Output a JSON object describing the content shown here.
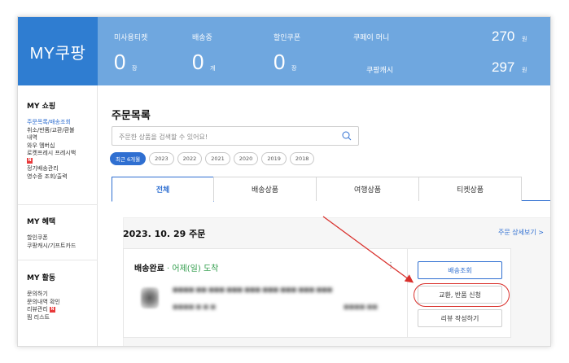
{
  "brand": {
    "title": "MY쿠팡"
  },
  "stats": {
    "items": [
      {
        "label": "미사용티켓",
        "value": "0",
        "unit": "장"
      },
      {
        "label": "배송중",
        "value": "0",
        "unit": "개"
      },
      {
        "label": "할인쿠폰",
        "value": "0",
        "unit": "장"
      }
    ],
    "right": [
      {
        "label": "쿠페이 머니",
        "value": "270",
        "unit": "원"
      },
      {
        "label": "쿠팡캐시",
        "value": "297",
        "unit": "원"
      }
    ]
  },
  "sidebar": {
    "sections": [
      {
        "title": "MY 쇼핑",
        "items": [
          {
            "label": "주문목록/배송조회",
            "active": true
          },
          {
            "label": "취소/반품/교환/환불"
          },
          {
            "label": "내역"
          },
          {
            "label": "와우 멤버십"
          },
          {
            "label": "로켓프레시 프레시백"
          },
          {
            "label": "",
            "badge": "N"
          },
          {
            "label": "정기배송관리"
          },
          {
            "label": "영수증 조회/출력"
          }
        ]
      },
      {
        "title": "MY 혜택",
        "items": [
          {
            "label": "할인쿠폰"
          },
          {
            "label": "쿠팡캐시/기프트카드"
          }
        ]
      },
      {
        "title": "MY 활동",
        "items": [
          {
            "label": "문의하기"
          },
          {
            "label": "문의내역 확인"
          },
          {
            "label": "리뷰관리",
            "badge": "N"
          },
          {
            "label": "찜 리스트"
          }
        ]
      }
    ]
  },
  "main": {
    "title": "주문목록",
    "search_placeholder": "주문한 상품을 검색할 수 있어요!",
    "year_chips": [
      "최근 6개월",
      "2023",
      "2022",
      "2021",
      "2020",
      "2019",
      "2018"
    ],
    "tabs": [
      "전체",
      "배송상품",
      "여행상품",
      "티켓상품"
    ],
    "order": {
      "date": "2023. 10. 29 주문",
      "detail_link": "주문 상세보기 >",
      "status": "배송완료",
      "separator": "·",
      "eta": "어제(일) 도착",
      "product_name": "■■■■ ■■ ■■■ ■■■ ■■■ ■■■ ■■■ ■■■ ■■■",
      "product_sub": "■■■■ ■ ■ ■",
      "product_price": "■■■■ ■■",
      "buttons": [
        "배송조회",
        "교환, 반품 신청",
        "리뷰 작성하기"
      ]
    }
  },
  "colors": {
    "brand": "#2f7dd1",
    "stats_bg": "#6fa7df",
    "accent": "#2f6fd1",
    "highlight": "#d9302c"
  }
}
